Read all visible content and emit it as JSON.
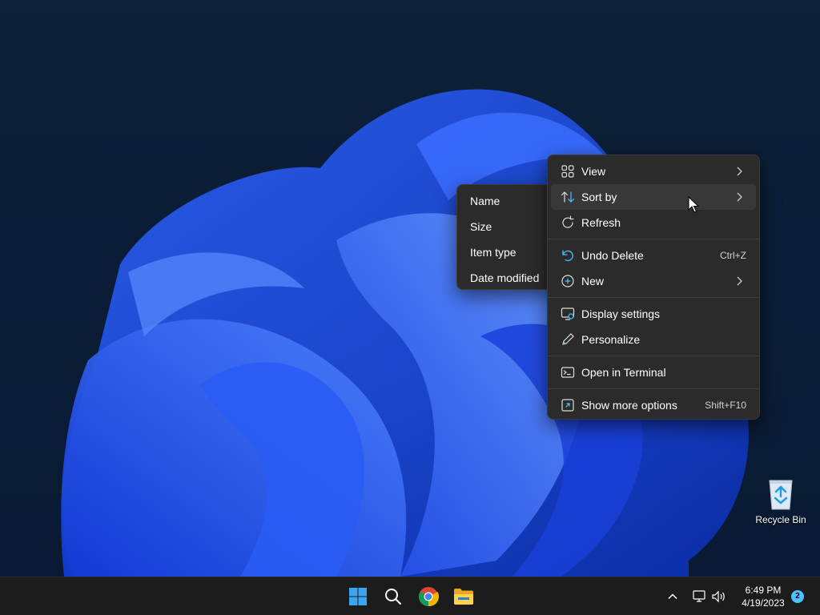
{
  "desktop": {
    "recycle_bin": {
      "label": "Recycle Bin"
    }
  },
  "context_menu": {
    "items": [
      {
        "label": "View",
        "icon": "view-grid-icon",
        "submenu": true
      },
      {
        "label": "Sort by",
        "icon": "sort-icon",
        "submenu": true,
        "highlighted": true
      },
      {
        "label": "Refresh",
        "icon": "refresh-icon"
      },
      {
        "label": "Undo Delete",
        "icon": "undo-icon",
        "shortcut": "Ctrl+Z"
      },
      {
        "label": "New",
        "icon": "new-plus-icon",
        "submenu": true
      },
      {
        "label": "Display settings",
        "icon": "display-settings-icon"
      },
      {
        "label": "Personalize",
        "icon": "pen-icon"
      },
      {
        "label": "Open in Terminal",
        "icon": "terminal-icon"
      },
      {
        "label": "Show more options",
        "icon": "more-options-icon",
        "shortcut": "Shift+F10"
      }
    ]
  },
  "sort_submenu": {
    "items": [
      {
        "label": "Name"
      },
      {
        "label": "Size"
      },
      {
        "label": "Item type"
      },
      {
        "label": "Date modified"
      }
    ]
  },
  "taskbar": {
    "apps": [
      {
        "name": "Start",
        "icon": "windows-start-icon"
      },
      {
        "name": "Search",
        "icon": "search-icon"
      },
      {
        "name": "Google Chrome",
        "icon": "chrome-icon"
      },
      {
        "name": "File Explorer",
        "icon": "folder-icon"
      }
    ],
    "tray": {
      "time": "6:49 PM",
      "date": "4/19/2023",
      "notification_count": "2"
    }
  },
  "colors": {
    "menu_bg": "#2b2b2b",
    "menu_highlight": "#383838",
    "accent": "#4cc2ff",
    "taskbar_bg": "#1c1c1c"
  }
}
